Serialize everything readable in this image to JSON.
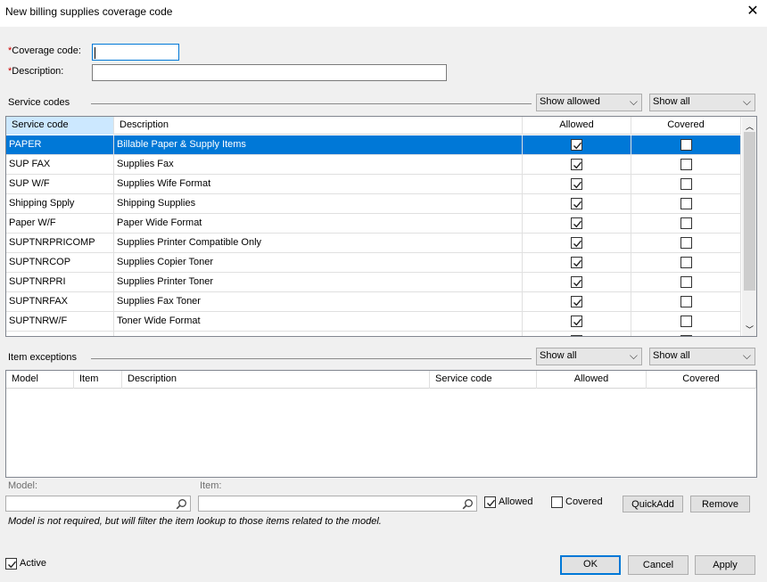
{
  "window": {
    "title": "New billing supplies coverage code",
    "close_glyph": "✕"
  },
  "form": {
    "required_mark": "*",
    "coverage_label": "Coverage code:",
    "coverage_value": "",
    "description_label": "Description:",
    "description_value": ""
  },
  "service_codes": {
    "section_label": "Service codes",
    "filter1": "Show allowed",
    "filter2": "Show all",
    "columns": {
      "code": "Service code",
      "description": "Description",
      "allowed": "Allowed",
      "covered": "Covered"
    },
    "rows": [
      {
        "code": "PAPER",
        "description": "Billable Paper & Supply Items",
        "allowed": true,
        "covered": false,
        "selected": true
      },
      {
        "code": "SUP FAX",
        "description": "Supplies Fax",
        "allowed": true,
        "covered": false
      },
      {
        "code": "SUP W/F",
        "description": "Supplies Wife Format",
        "allowed": true,
        "covered": false
      },
      {
        "code": "Shipping Spply",
        "description": "Shipping Supplies",
        "allowed": true,
        "covered": false
      },
      {
        "code": "Paper W/F",
        "description": "Paper Wide Format",
        "allowed": true,
        "covered": false
      },
      {
        "code": "SUPTNRPRICOMP",
        "description": "Supplies Printer Compatible Only",
        "allowed": true,
        "covered": false
      },
      {
        "code": "SUPTNRCOP",
        "description": "Supplies Copier Toner",
        "allowed": true,
        "covered": false
      },
      {
        "code": "SUPTNRPRI",
        "description": "Supplies Printer Toner",
        "allowed": true,
        "covered": false
      },
      {
        "code": "SUPTNRFAX",
        "description": "Supplies Fax Toner",
        "allowed": true,
        "covered": false
      },
      {
        "code": "SUPTNRW/F",
        "description": "Toner Wide Format",
        "allowed": true,
        "covered": false
      },
      {
        "code": "",
        "description": "",
        "allowed": true,
        "covered": false
      }
    ]
  },
  "item_exceptions": {
    "section_label": "Item exceptions",
    "filter1": "Show all",
    "filter2": "Show all",
    "columns": {
      "model": "Model",
      "item": "Item",
      "description": "Description",
      "service_code": "Service code",
      "allowed": "Allowed",
      "covered": "Covered"
    }
  },
  "quick_add": {
    "model_label": "Model:",
    "item_label": "Item:",
    "model_value": "",
    "item_value": "",
    "allowed_label": "Allowed",
    "allowed_checked": true,
    "covered_label": "Covered",
    "covered_checked": false,
    "quickadd_label": "QuickAdd",
    "remove_label": "Remove",
    "note": "Model is not required, but will filter the item lookup to those items related to the model."
  },
  "footer": {
    "active_label": "Active",
    "active_checked": true,
    "ok_label": "OK",
    "cancel_label": "Cancel",
    "apply_label": "Apply"
  },
  "colors": {
    "selection": "#0078d7",
    "required": "#cc0000",
    "header_selected": "#cce8ff"
  }
}
